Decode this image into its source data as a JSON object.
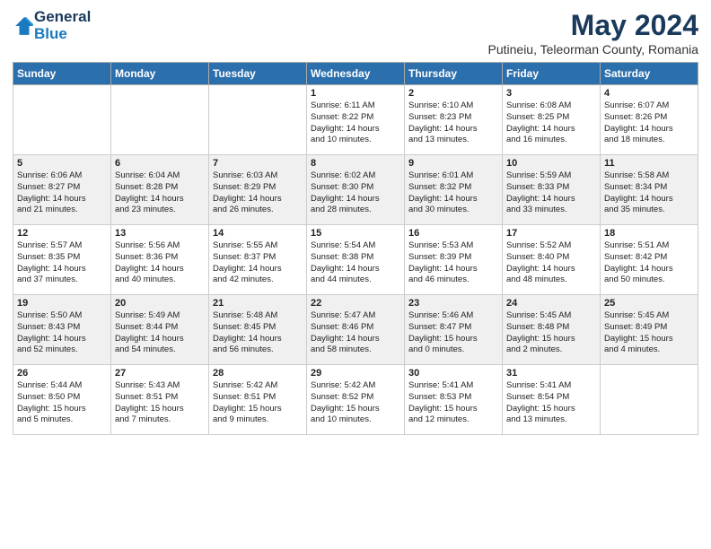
{
  "logo": {
    "general": "General",
    "blue": "Blue"
  },
  "title": "May 2024",
  "subtitle": "Putineiu, Teleorman County, Romania",
  "headers": [
    "Sunday",
    "Monday",
    "Tuesday",
    "Wednesday",
    "Thursday",
    "Friday",
    "Saturday"
  ],
  "weeks": [
    [
      {
        "day": "",
        "info": ""
      },
      {
        "day": "",
        "info": ""
      },
      {
        "day": "",
        "info": ""
      },
      {
        "day": "1",
        "info": "Sunrise: 6:11 AM\nSunset: 8:22 PM\nDaylight: 14 hours\nand 10 minutes."
      },
      {
        "day": "2",
        "info": "Sunrise: 6:10 AM\nSunset: 8:23 PM\nDaylight: 14 hours\nand 13 minutes."
      },
      {
        "day": "3",
        "info": "Sunrise: 6:08 AM\nSunset: 8:25 PM\nDaylight: 14 hours\nand 16 minutes."
      },
      {
        "day": "4",
        "info": "Sunrise: 6:07 AM\nSunset: 8:26 PM\nDaylight: 14 hours\nand 18 minutes."
      }
    ],
    [
      {
        "day": "5",
        "info": "Sunrise: 6:06 AM\nSunset: 8:27 PM\nDaylight: 14 hours\nand 21 minutes."
      },
      {
        "day": "6",
        "info": "Sunrise: 6:04 AM\nSunset: 8:28 PM\nDaylight: 14 hours\nand 23 minutes."
      },
      {
        "day": "7",
        "info": "Sunrise: 6:03 AM\nSunset: 8:29 PM\nDaylight: 14 hours\nand 26 minutes."
      },
      {
        "day": "8",
        "info": "Sunrise: 6:02 AM\nSunset: 8:30 PM\nDaylight: 14 hours\nand 28 minutes."
      },
      {
        "day": "9",
        "info": "Sunrise: 6:01 AM\nSunset: 8:32 PM\nDaylight: 14 hours\nand 30 minutes."
      },
      {
        "day": "10",
        "info": "Sunrise: 5:59 AM\nSunset: 8:33 PM\nDaylight: 14 hours\nand 33 minutes."
      },
      {
        "day": "11",
        "info": "Sunrise: 5:58 AM\nSunset: 8:34 PM\nDaylight: 14 hours\nand 35 minutes."
      }
    ],
    [
      {
        "day": "12",
        "info": "Sunrise: 5:57 AM\nSunset: 8:35 PM\nDaylight: 14 hours\nand 37 minutes."
      },
      {
        "day": "13",
        "info": "Sunrise: 5:56 AM\nSunset: 8:36 PM\nDaylight: 14 hours\nand 40 minutes."
      },
      {
        "day": "14",
        "info": "Sunrise: 5:55 AM\nSunset: 8:37 PM\nDaylight: 14 hours\nand 42 minutes."
      },
      {
        "day": "15",
        "info": "Sunrise: 5:54 AM\nSunset: 8:38 PM\nDaylight: 14 hours\nand 44 minutes."
      },
      {
        "day": "16",
        "info": "Sunrise: 5:53 AM\nSunset: 8:39 PM\nDaylight: 14 hours\nand 46 minutes."
      },
      {
        "day": "17",
        "info": "Sunrise: 5:52 AM\nSunset: 8:40 PM\nDaylight: 14 hours\nand 48 minutes."
      },
      {
        "day": "18",
        "info": "Sunrise: 5:51 AM\nSunset: 8:42 PM\nDaylight: 14 hours\nand 50 minutes."
      }
    ],
    [
      {
        "day": "19",
        "info": "Sunrise: 5:50 AM\nSunset: 8:43 PM\nDaylight: 14 hours\nand 52 minutes."
      },
      {
        "day": "20",
        "info": "Sunrise: 5:49 AM\nSunset: 8:44 PM\nDaylight: 14 hours\nand 54 minutes."
      },
      {
        "day": "21",
        "info": "Sunrise: 5:48 AM\nSunset: 8:45 PM\nDaylight: 14 hours\nand 56 minutes."
      },
      {
        "day": "22",
        "info": "Sunrise: 5:47 AM\nSunset: 8:46 PM\nDaylight: 14 hours\nand 58 minutes."
      },
      {
        "day": "23",
        "info": "Sunrise: 5:46 AM\nSunset: 8:47 PM\nDaylight: 15 hours\nand 0 minutes."
      },
      {
        "day": "24",
        "info": "Sunrise: 5:45 AM\nSunset: 8:48 PM\nDaylight: 15 hours\nand 2 minutes."
      },
      {
        "day": "25",
        "info": "Sunrise: 5:45 AM\nSunset: 8:49 PM\nDaylight: 15 hours\nand 4 minutes."
      }
    ],
    [
      {
        "day": "26",
        "info": "Sunrise: 5:44 AM\nSunset: 8:50 PM\nDaylight: 15 hours\nand 5 minutes."
      },
      {
        "day": "27",
        "info": "Sunrise: 5:43 AM\nSunset: 8:51 PM\nDaylight: 15 hours\nand 7 minutes."
      },
      {
        "day": "28",
        "info": "Sunrise: 5:42 AM\nSunset: 8:51 PM\nDaylight: 15 hours\nand 9 minutes."
      },
      {
        "day": "29",
        "info": "Sunrise: 5:42 AM\nSunset: 8:52 PM\nDaylight: 15 hours\nand 10 minutes."
      },
      {
        "day": "30",
        "info": "Sunrise: 5:41 AM\nSunset: 8:53 PM\nDaylight: 15 hours\nand 12 minutes."
      },
      {
        "day": "31",
        "info": "Sunrise: 5:41 AM\nSunset: 8:54 PM\nDaylight: 15 hours\nand 13 minutes."
      },
      {
        "day": "",
        "info": ""
      }
    ]
  ]
}
